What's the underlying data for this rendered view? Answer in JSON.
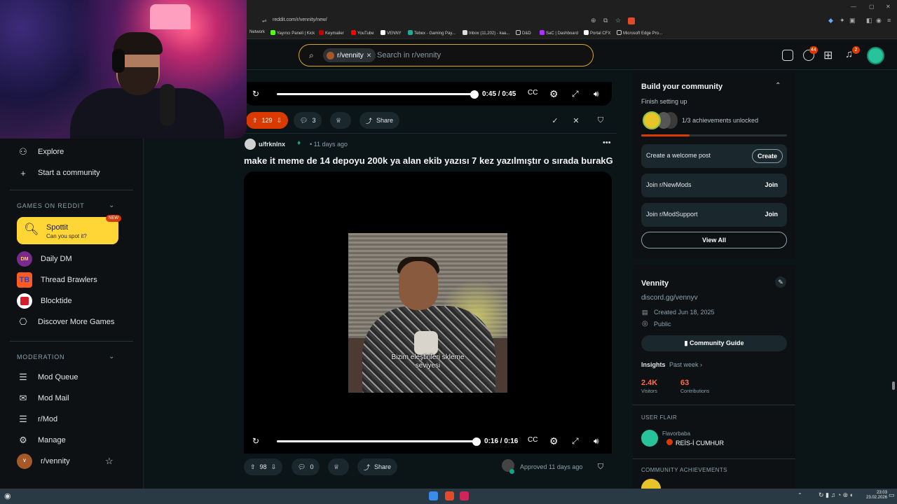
{
  "browser": {
    "url": "reddit.com/r/vennity/new/",
    "bookmarks": [
      "Network",
      "Yayıncı Paneli | Kick",
      "Keymailer",
      "YouTube",
      "VENNY",
      "Tebex - Gaming Pay...",
      "Inbox (11,202) - kaa...",
      "D&D",
      "SaC | Dashboard",
      "Portal CFX",
      "Microsoft Edge Pro..."
    ]
  },
  "header": {
    "community_chip": "r/vennity",
    "search_placeholder": "Search in r/vennity",
    "chat_badge": "44",
    "notif_badge": "2"
  },
  "sidebar": {
    "explore": "Explore",
    "start_community": "Start a community",
    "games_heading": "GAMES ON REDDIT",
    "spottit_title": "Spottit",
    "spottit_sub": "Can you spot it?",
    "spottit_badge": "NEW",
    "games": [
      "Daily DM",
      "Thread Brawlers",
      "Blocktide",
      "Discover More Games"
    ],
    "moderation_heading": "MODERATION",
    "mod_items": [
      "Mod Queue",
      "Mod Mail",
      "r/Mod",
      "Manage"
    ],
    "community": "r/vennity"
  },
  "post1": {
    "video_time": "0:45 / 0:45",
    "progress": 1.0,
    "votes": "129",
    "comments": "3",
    "share": "Share"
  },
  "post2": {
    "author": "u/frknlnx",
    "age": "• 11 days ago",
    "title": "make it meme de 14 depoyu 200k ya alan ekib yazısı 7 kez yazılmıştır o sırada burakG",
    "caption_line1": "Bizim eleştirileri skleme",
    "caption_line2": "seviyesi",
    "video_time": "0:16 / 0:16",
    "progress": 1.0,
    "votes": "98",
    "comments": "0",
    "share": "Share",
    "approved": "Approved 11 days ago"
  },
  "right": {
    "build_title": "Build your community",
    "finish_setup": "Finish setting up",
    "achievements": "1/3 achievements unlocked",
    "achievements_progress": 0.33,
    "tasks": [
      {
        "label": "Create a welcome post",
        "action": "Create"
      },
      {
        "label": "Join r/NewMods",
        "action": "Join"
      },
      {
        "label": "Join r/ModSupport",
        "action": "Join"
      }
    ],
    "view_all": "View All",
    "community_name": "Vennity",
    "community_link": "discord.gg/vennyv",
    "created": "Created Jun 18, 2025",
    "visibility": "Public",
    "guide": "Community Guide",
    "insights": "Insights",
    "insights_period": "Past week",
    "visitors_value": "2.4K",
    "visitors_label": "Visitors",
    "contrib_value": "63",
    "contrib_label": "Contributions",
    "user_flair_heading": "USER FLAIR",
    "flair_user": "Flavorbaba",
    "flair_text": "REİS-İ CUMHUR",
    "community_achievements": "COMMUNITY ACHIEVEMENTS"
  },
  "taskbar": {
    "time": "23:03",
    "date": "23.02.2026"
  },
  "colors": {
    "accent": "#d93a00",
    "background": "#0b1416",
    "chip": "#1a282d",
    "spottit": "#ffd635",
    "insight_red": "#ff6a4a"
  }
}
